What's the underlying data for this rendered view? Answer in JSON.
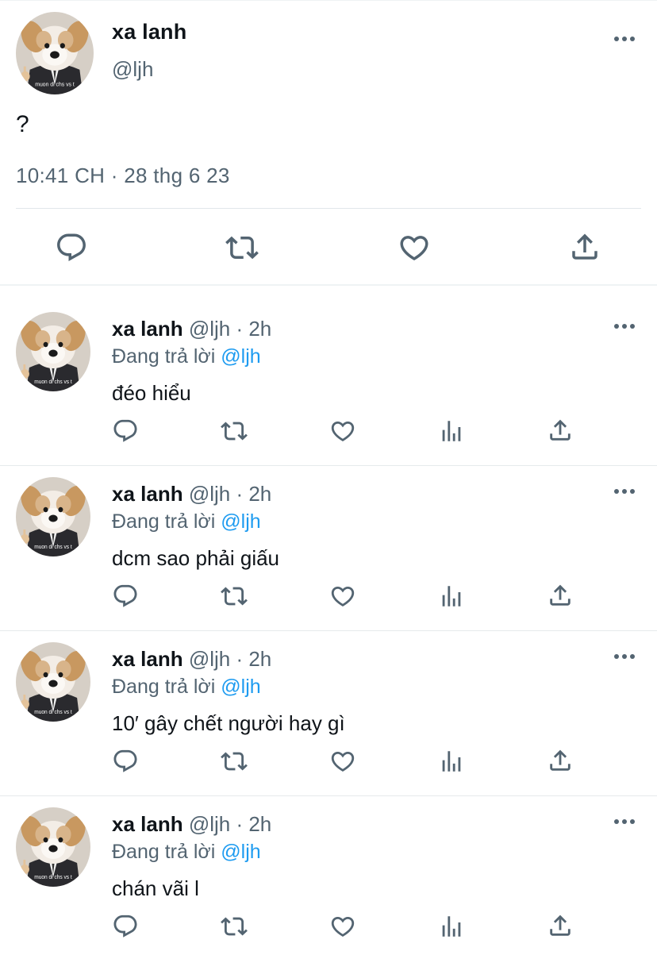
{
  "main_tweet": {
    "name": "xa lanh",
    "handle": "@ljh",
    "text": "?",
    "timestamp": "10:41 CH · 28 thg 6 23",
    "avatar_caption": "muon di chs vs t",
    "icons": [
      "reply-icon",
      "retweet-icon",
      "like-icon",
      "share-icon",
      "more-icon"
    ]
  },
  "replies": [
    {
      "name": "xa lanh",
      "meta": "@ljh · 2h",
      "replying_prefix": "Đang trả lời",
      "replying_mention": "@ljh",
      "text": "đéo hiểu",
      "avatar_caption": "muon di chs vs t"
    },
    {
      "name": "xa lanh",
      "meta": "@ljh · 2h",
      "replying_prefix": "Đang trả lời",
      "replying_mention": "@ljh",
      "text": "dcm sao phải giấu",
      "avatar_caption": "muon di chs vs t"
    },
    {
      "name": "xa lanh",
      "meta": "@ljh · 2h",
      "replying_prefix": "Đang trả lời",
      "replying_mention": "@ljh",
      "text": "10′ gây chết người hay gì",
      "avatar_caption": "muon di chs vs t"
    },
    {
      "name": "xa lanh",
      "meta": "@ljh · 2h",
      "replying_prefix": "Đang trả lời",
      "replying_mention": "@ljh",
      "text": "chán vãi l",
      "avatar_caption": "muon di chs vs t"
    }
  ],
  "colors": {
    "text": "#0f1419",
    "secondary": "#536471",
    "mention": "#1d9bf0",
    "icon": "#536471",
    "divider": "#eff3f4"
  },
  "reply_icons": [
    "reply-icon",
    "retweet-icon",
    "like-icon",
    "views-icon",
    "share-icon",
    "more-icon"
  ]
}
